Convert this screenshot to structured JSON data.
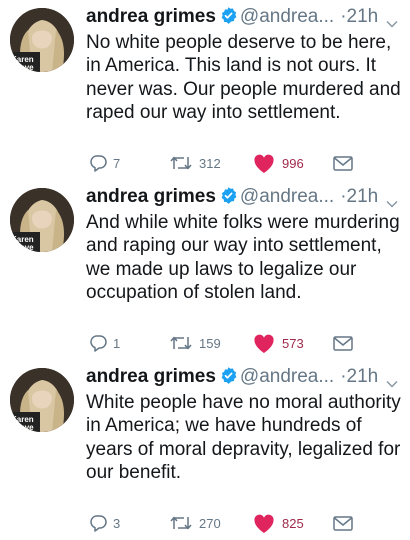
{
  "tweets": [
    {
      "display_name": "andrea grimes",
      "handle": "@andrea...",
      "separator": "·",
      "time": "21h",
      "text": "No white people deserve to be here, in America. This land is not ours. It never was. Our people murdered and raped our way into settlement.",
      "replies": "7",
      "retweets": "312",
      "likes": "996"
    },
    {
      "display_name": "andrea grimes",
      "handle": "@andrea...",
      "separator": "·",
      "time": "21h",
      "text": "And while white folks were murdering and raping our way into settlement, we made up laws to legalize our occupation of stolen land.",
      "replies": "1",
      "retweets": "159",
      "likes": "573"
    },
    {
      "display_name": "andrea grimes",
      "handle": "@andrea...",
      "separator": "·",
      "time": "21h",
      "text": "White people have no moral authority in America; we have hundreds of years of moral depravity, legalized for our benefit.",
      "replies": "3",
      "retweets": "270",
      "likes": "825"
    }
  ],
  "avatar_text": "Karen Wave",
  "colors": {
    "verified": "#1da1f2",
    "like_heart": "#e0245e",
    "like_count": "#9e2a4a",
    "muted": "#657786"
  },
  "icons": {
    "reply": "reply-icon",
    "retweet": "retweet-icon",
    "like": "heart-icon",
    "dm": "envelope-icon",
    "verified": "verified-badge-icon",
    "caret": "chevron-down-icon"
  }
}
